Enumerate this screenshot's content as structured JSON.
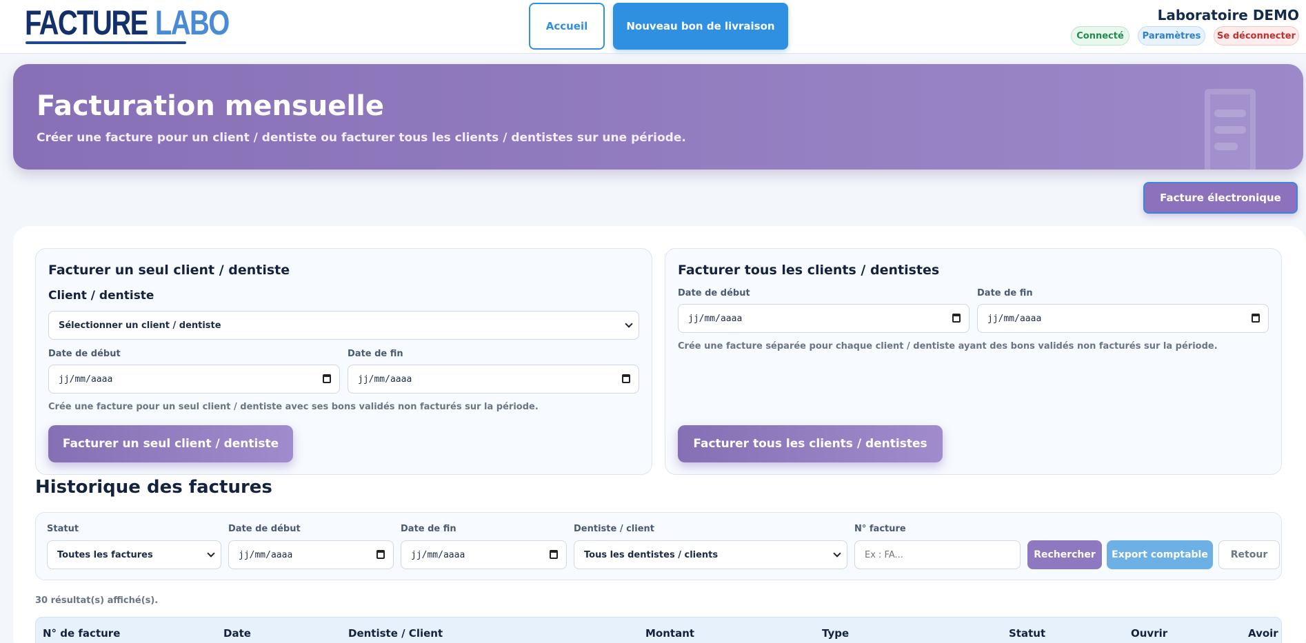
{
  "header": {
    "logo_part1": "FACTURE",
    "logo_part2": "LABO",
    "home_label": "Accueil",
    "new_delivery_label": "Nouveau bon de livraison",
    "lab_name": "Laboratoire DEMO",
    "status_label": "Connecté",
    "settings_label": "Paramètres",
    "logout_label": "Se déconnecter"
  },
  "hero": {
    "title": "Facturation mensuelle",
    "subtitle": "Créer une facture pour un client / dentiste ou facturer tous les clients / dentistes sur une période."
  },
  "einvoice_label": "Facture électronique",
  "single": {
    "title": "Facturer un seul client / dentiste",
    "client_label": "Client / dentiste",
    "client_select": "Sélectionner un client / dentiste",
    "start_label": "Date de début",
    "start_value": "jj/mm/aaaa",
    "end_label": "Date de fin",
    "end_value": "jj/mm/aaaa",
    "hint": "Crée une facture pour un seul client / dentiste avec ses bons validés non facturés sur la période.",
    "button": "Facturer un seul client / dentiste"
  },
  "all": {
    "title": "Facturer tous les clients / dentistes",
    "start_label": "Date de début",
    "start_value": "jj/mm/aaaa",
    "end_label": "Date de fin",
    "end_value": "jj/mm/aaaa",
    "hint": "Crée une facture séparée pour chaque client / dentiste ayant des bons validés non facturés sur la période.",
    "button": "Facturer tous les clients / dentistes"
  },
  "history": {
    "title": "Historique des factures",
    "filters": {
      "status_label": "Statut",
      "status_value": "Toutes les factures",
      "start_label": "Date de début",
      "start_value": "jj/mm/aaaa",
      "end_label": "Date de fin",
      "end_value": "jj/mm/aaaa",
      "dentist_label": "Dentiste / client",
      "dentist_value": "Tous les dentistes / clients",
      "number_label": "N° facture",
      "number_placeholder": "Ex : FA...",
      "search_label": "Rechercher",
      "export_label": "Export comptable",
      "back_label": "Retour"
    },
    "results_text": "30 résultat(s) affiché(s).",
    "columns": [
      "N° de facture",
      "Date",
      "Dentiste / Client",
      "Montant",
      "Type",
      "Statut",
      "Ouvrir",
      "Avoir"
    ]
  },
  "colors": {
    "accent_blue": "#2f8fe0",
    "accent_purple": "#8870b6",
    "navy": "#14223d"
  }
}
